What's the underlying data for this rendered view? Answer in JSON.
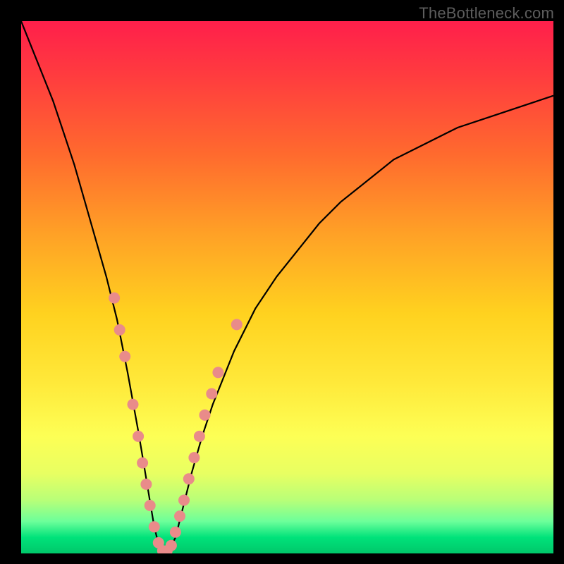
{
  "watermark": "TheBottleneck.com",
  "colors": {
    "curve_stroke": "#000000",
    "marker_fill": "#e98b8a",
    "marker_stroke": "#c06a68",
    "green_band": "#00c86a"
  },
  "chart_data": {
    "type": "line",
    "title": "",
    "xlabel": "",
    "ylabel": "",
    "xlim": [
      0,
      100
    ],
    "ylim": [
      0,
      100
    ],
    "grid": false,
    "legend": false,
    "series": [
      {
        "name": "bottleneck-curve",
        "x": [
          0,
          2,
          4,
          6,
          8,
          10,
          12,
          14,
          16,
          18,
          20,
          22,
          23,
          24,
          25,
          26,
          27,
          28,
          29,
          30,
          32,
          34,
          36,
          38,
          40,
          44,
          48,
          52,
          56,
          60,
          65,
          70,
          76,
          82,
          88,
          94,
          100
        ],
        "y": [
          100,
          95,
          90,
          85,
          79,
          73,
          66,
          59,
          52,
          44,
          34,
          23,
          17,
          11,
          5,
          1,
          0,
          1,
          3,
          7,
          15,
          22,
          28,
          33,
          38,
          46,
          52,
          57,
          62,
          66,
          70,
          74,
          77,
          80,
          82,
          84,
          86
        ]
      }
    ],
    "markers": [
      {
        "x": 17.5,
        "y": 48
      },
      {
        "x": 18.5,
        "y": 42
      },
      {
        "x": 19.5,
        "y": 37
      },
      {
        "x": 21.0,
        "y": 28
      },
      {
        "x": 22.0,
        "y": 22
      },
      {
        "x": 22.8,
        "y": 17
      },
      {
        "x": 23.5,
        "y": 13
      },
      {
        "x": 24.2,
        "y": 9
      },
      {
        "x": 25.0,
        "y": 5
      },
      {
        "x": 25.8,
        "y": 2
      },
      {
        "x": 26.6,
        "y": 0.5
      },
      {
        "x": 27.4,
        "y": 0.5
      },
      {
        "x": 28.2,
        "y": 1.5
      },
      {
        "x": 29.0,
        "y": 4
      },
      {
        "x": 29.8,
        "y": 7
      },
      {
        "x": 30.6,
        "y": 10
      },
      {
        "x": 31.5,
        "y": 14
      },
      {
        "x": 32.5,
        "y": 18
      },
      {
        "x": 33.5,
        "y": 22
      },
      {
        "x": 34.5,
        "y": 26
      },
      {
        "x": 35.8,
        "y": 30
      },
      {
        "x": 37.0,
        "y": 34
      },
      {
        "x": 40.5,
        "y": 43
      }
    ]
  }
}
